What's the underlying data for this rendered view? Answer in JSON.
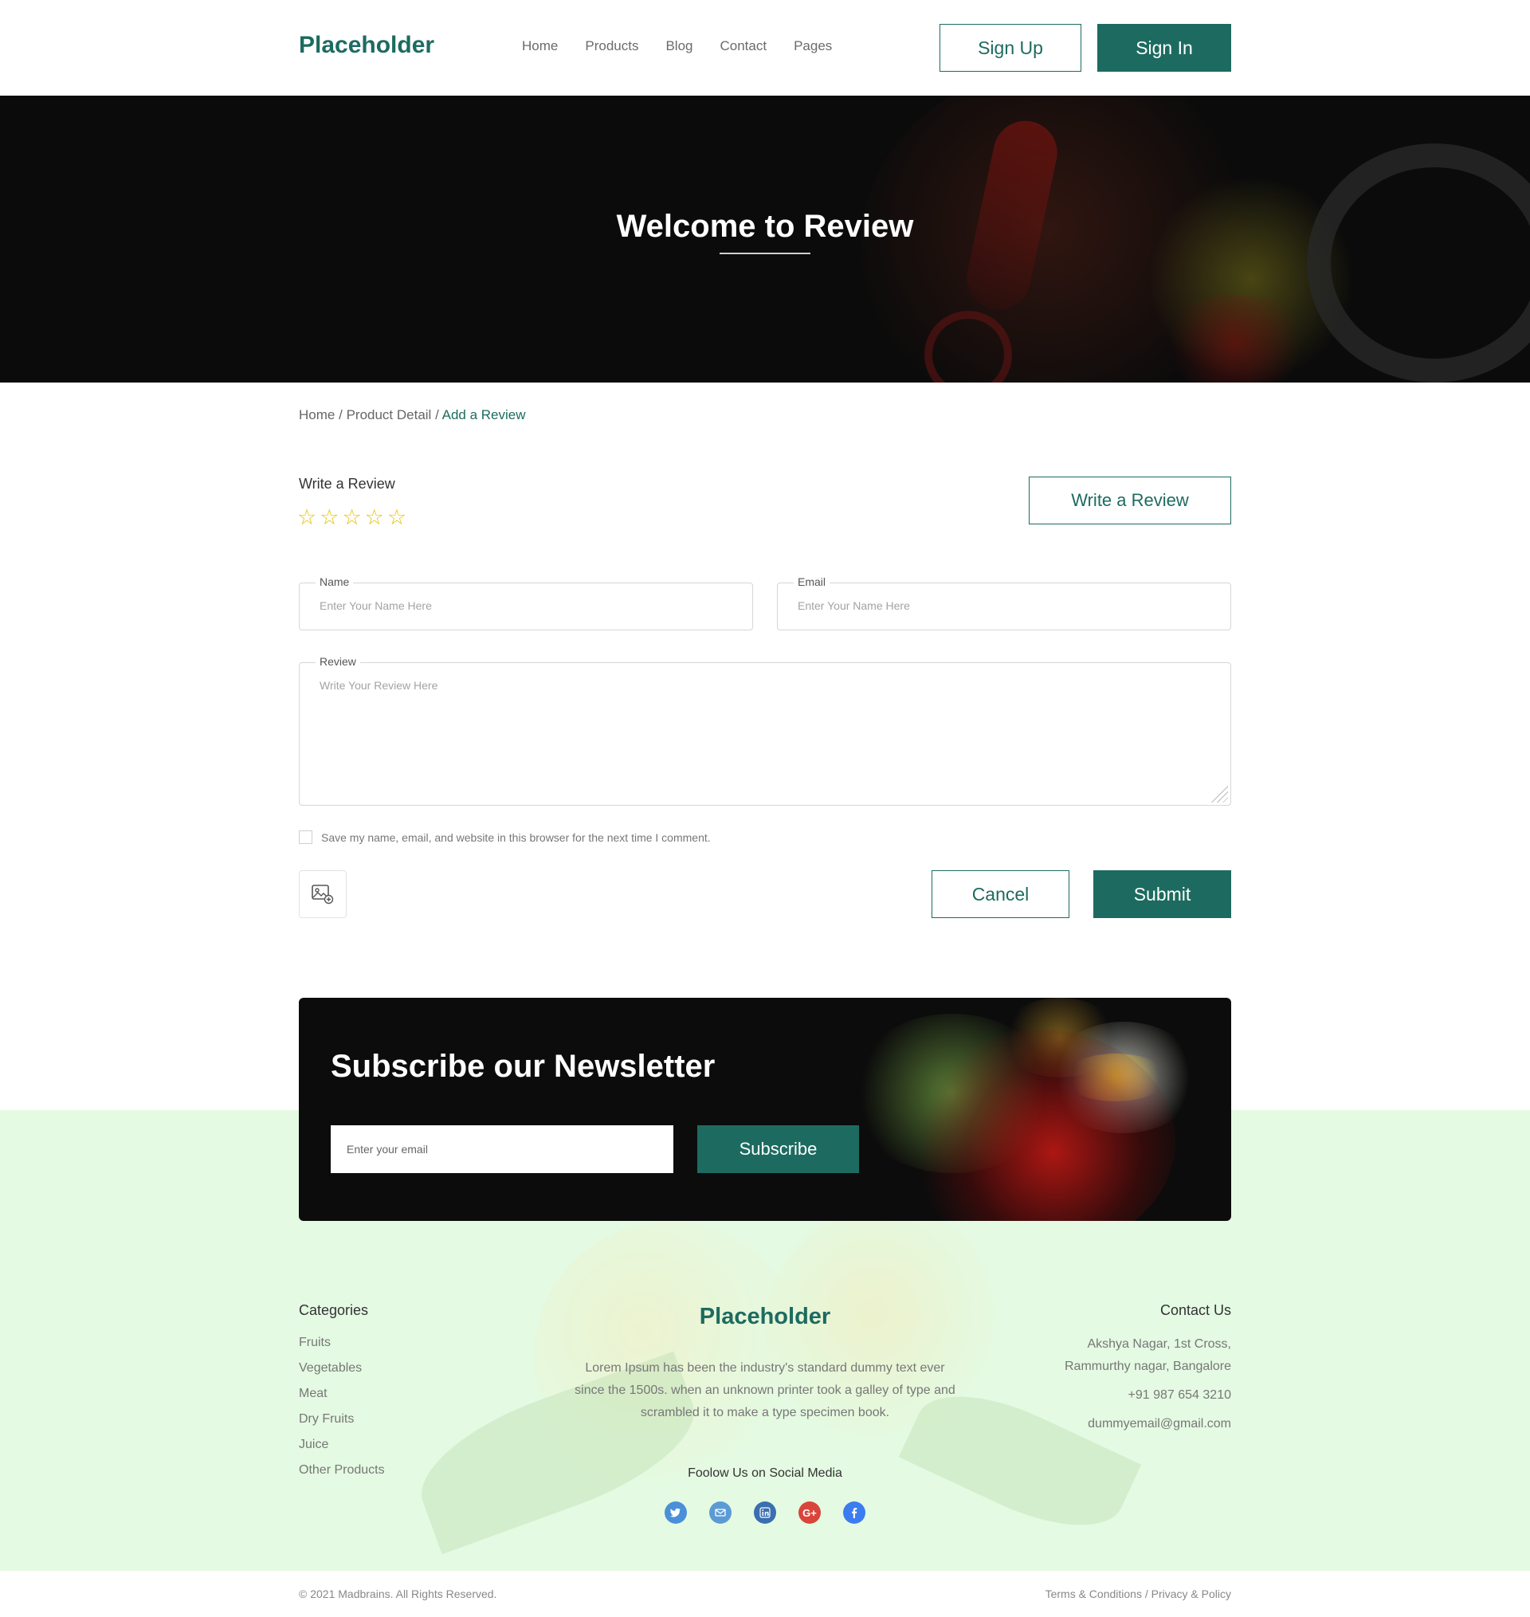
{
  "header": {
    "logo": "Placeholder",
    "nav": [
      "Home",
      "Products",
      "Blog",
      "Contact",
      "Pages"
    ],
    "signup_label": "Sign Up",
    "signin_label": "Sign In"
  },
  "hero": {
    "title": "Welcome to Review"
  },
  "breadcrumb": {
    "home": "Home",
    "separator": "/",
    "product_detail": "Product Detail",
    "current": "Add a Review"
  },
  "review": {
    "title": "Write a Review",
    "rating_max": 5,
    "rating": 0,
    "write_button": "Write a Review",
    "name_label": "Name",
    "name_placeholder": "Enter Your Name Here",
    "email_label": "Email",
    "email_placeholder": "Enter Your Name Here",
    "review_label": "Review",
    "review_placeholder": "Write Your Review Here",
    "save_info_label": "Save my name, email, and website in this browser for the next time I comment.",
    "cancel_label": "Cancel",
    "submit_label": "Submit"
  },
  "newsletter": {
    "title": "Subscribe our Newsletter",
    "email_placeholder": "Enter your email",
    "subscribe_label": "Subscribe"
  },
  "footer": {
    "categories_title": "Categories",
    "categories": [
      "Fruits",
      "Vegetables",
      "Meat",
      "Dry Fruits",
      "Juice",
      "Other Products"
    ],
    "logo": "Placeholder",
    "about": "Lorem Ipsum has been the industry's standard dummy text ever since the 1500s. when an unknown printer took a galley of type and scrambled it to make a type specimen book.",
    "follow_label": "Foolow Us on Social Media",
    "socials": [
      {
        "icon": "twitter-icon",
        "color": "#4a90d9"
      },
      {
        "icon": "mail-icon",
        "color": "#5b9bd5"
      },
      {
        "icon": "linkedin-icon",
        "color": "#3a6fb0"
      },
      {
        "icon": "google-plus-icon",
        "color": "#d9453a"
      },
      {
        "icon": "facebook-icon",
        "color": "#3b7cf0"
      }
    ],
    "contact_title": "Contact Us",
    "address_line1": "Akshya Nagar, 1st Cross,",
    "address_line2": "Rammurthy nagar, Bangalore",
    "phone": "+91 987 654 3210",
    "email": "dummyemail@gmail.com",
    "copyright": "© 2021 Madbrains. All Rights Reserved.",
    "terms": "Terms & Conditions",
    "legal_separator": "/",
    "privacy": "Privacy & Policy"
  },
  "colors": {
    "brand": "#1d6b60",
    "star": "#e6c200",
    "footer_bg": "#e4fae2"
  }
}
